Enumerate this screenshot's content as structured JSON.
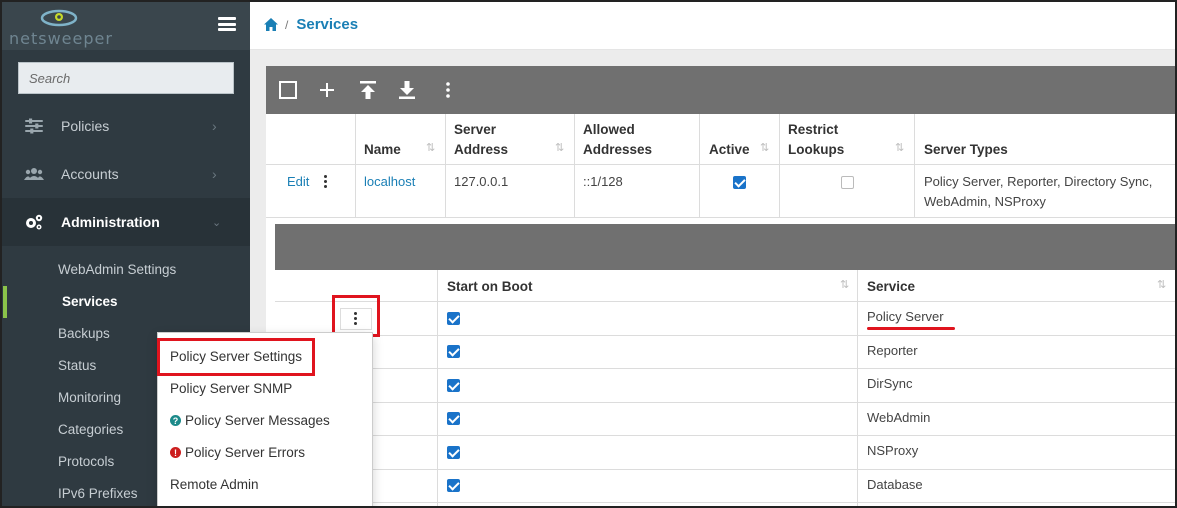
{
  "brand": {
    "name": "netsweeper"
  },
  "search": {
    "placeholder": "Search"
  },
  "sidebar": {
    "nav": [
      {
        "label": "Policies",
        "icon": "sliders-icon"
      },
      {
        "label": "Accounts",
        "icon": "users-icon"
      },
      {
        "label": "Administration",
        "icon": "cogs-icon"
      }
    ],
    "sub": [
      {
        "label": "WebAdmin Settings"
      },
      {
        "label": "Services"
      },
      {
        "label": "Backups"
      },
      {
        "label": "Status"
      },
      {
        "label": "Monitoring"
      },
      {
        "label": "Categories"
      },
      {
        "label": "Protocols"
      },
      {
        "label": "IPv6 Prefixes"
      }
    ]
  },
  "breadcrumb": {
    "current": "Services",
    "separator": "/"
  },
  "servers_table": {
    "columns": [
      "Name",
      "Server Address",
      "Allowed Addresses",
      "Active",
      "Restrict Lookups",
      "Server Types"
    ],
    "column_lines": [
      [
        "",
        "Name"
      ],
      [
        "Server",
        "Address"
      ],
      [
        "Allowed",
        "Addresses"
      ],
      [
        "",
        "Active"
      ],
      [
        "Restrict",
        "Lookups"
      ],
      [
        "",
        "Server Types"
      ]
    ],
    "rows": [
      {
        "edit": "Edit",
        "name": "localhost",
        "server_address": "127.0.0.1",
        "allowed_addresses": "::1/128",
        "active": true,
        "restrict_lookups": false,
        "server_types_line1": "Policy Server, Reporter, Directory Sync,",
        "server_types_line2": "WebAdmin, NSProxy"
      }
    ]
  },
  "services_table": {
    "columns": [
      "Start on Boot",
      "Service"
    ],
    "rows": [
      {
        "start_on_boot": true,
        "service": "Policy Server"
      },
      {
        "start_on_boot": true,
        "service": "Reporter"
      },
      {
        "start_on_boot": true,
        "service": "DirSync"
      },
      {
        "start_on_boot": true,
        "service": "WebAdmin"
      },
      {
        "start_on_boot": true,
        "service": "NSProxy"
      },
      {
        "start_on_boot": true,
        "service": "Database"
      }
    ]
  },
  "context_menu": {
    "items": [
      {
        "label": "Policy Server Settings",
        "icon": ""
      },
      {
        "label": "Policy Server SNMP",
        "icon": ""
      },
      {
        "label": "Policy Server Messages",
        "icon": "question-icon"
      },
      {
        "label": "Policy Server Errors",
        "icon": "error-icon"
      },
      {
        "label": "Remote Admin",
        "icon": ""
      }
    ]
  },
  "colors": {
    "sidebar_bg": "#2f3a41",
    "accent_blue": "#1a7fb5",
    "active_marker": "#8bc34a",
    "highlight_red": "#e0141e",
    "toolbar_gray": "#707070"
  }
}
